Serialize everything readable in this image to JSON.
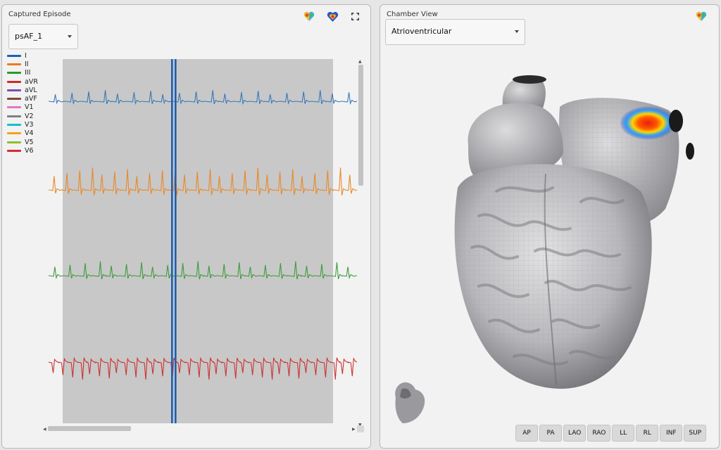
{
  "left_panel": {
    "title": "Captured Episode",
    "episode_select": {
      "value": "psAF_1"
    },
    "icons": [
      "heart-color-icon",
      "heart-map-icon",
      "fullscreen-icon"
    ]
  },
  "legend": [
    {
      "label": "I",
      "color": "#1f5fb0"
    },
    {
      "label": "II",
      "color": "#e87d1e"
    },
    {
      "label": "III",
      "color": "#2a9a2a"
    },
    {
      "label": "aVR",
      "color": "#cc2b2b"
    },
    {
      "label": "aVL",
      "color": "#7b4fb0"
    },
    {
      "label": "aVF",
      "color": "#7b4a3a"
    },
    {
      "label": "V1",
      "color": "#e377c2"
    },
    {
      "label": "V2",
      "color": "#7f7f7f"
    },
    {
      "label": "V3",
      "color": "#17becf"
    },
    {
      "label": "V4",
      "color": "#f2a31a"
    },
    {
      "label": "V5",
      "color": "#8fbf2a"
    },
    {
      "label": "V6",
      "color": "#d62d2d"
    }
  ],
  "traces": [
    {
      "lead": "I",
      "color": "#3b78b8"
    },
    {
      "lead": "II",
      "color": "#e8892a"
    },
    {
      "lead": "III",
      "color": "#3f9a3f"
    },
    {
      "lead": "aVR",
      "color": "#cc3333"
    }
  ],
  "right_panel": {
    "title": "Chamber View",
    "chamber_select": {
      "value": "Atrioventricular"
    },
    "view_buttons": [
      "AP",
      "PA",
      "LAO",
      "RAO",
      "LL",
      "RL",
      "INF",
      "SUP"
    ]
  }
}
